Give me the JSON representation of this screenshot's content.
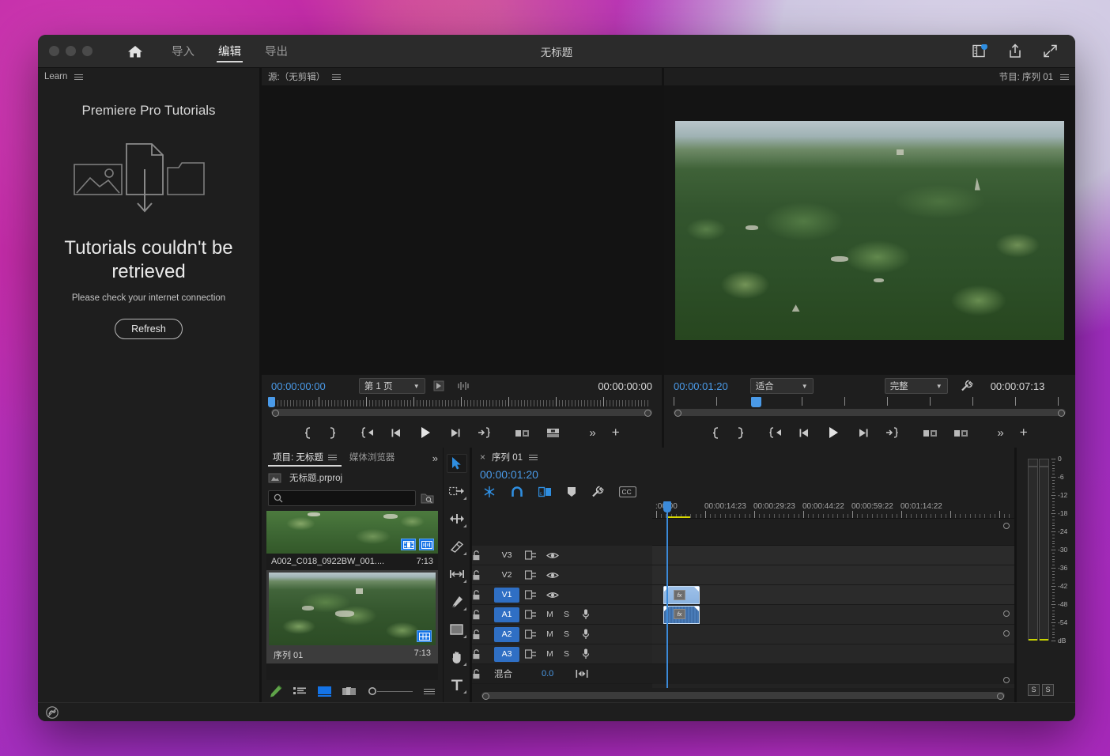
{
  "window": {
    "title": "无标题",
    "traffic_lights": [
      "close",
      "minimize",
      "maximize"
    ],
    "home_icon": "home-icon",
    "tabs": [
      {
        "label": "导入",
        "active": false
      },
      {
        "label": "编辑",
        "active": true
      },
      {
        "label": "导出",
        "active": false
      }
    ],
    "right_icons": [
      "progress-panel-icon",
      "share-icon",
      "fullscreen-icon"
    ]
  },
  "learn": {
    "panel_label": "Learn",
    "title": "Premiere Pro Tutorials",
    "error_title": "Tutorials couldn't be retrieved",
    "error_sub": "Please check your internet connection",
    "refresh_label": "Refresh"
  },
  "source_monitor": {
    "header": "源:（无剪辑）",
    "current_timecode": "00:00:00:00",
    "page_select": "第 1 页",
    "duration_timecode": "00:00:00:00",
    "transport": [
      "mark-in",
      "mark-out",
      "go-to-in",
      "step-back",
      "play",
      "step-forward",
      "go-to-out",
      "insert",
      "overwrite"
    ],
    "overflow_label": "»",
    "add_label": "+"
  },
  "program_monitor": {
    "header": "节目: 序列 01",
    "current_timecode": "00:00:01:20",
    "fit_select": "适合",
    "quality_select": "完整",
    "settings_icon": "wrench-icon",
    "duration_timecode": "00:00:07:13",
    "transport": [
      "mark-in",
      "mark-out",
      "go-to-in",
      "step-back",
      "play",
      "step-forward",
      "go-to-out",
      "lift",
      "extract"
    ],
    "overflow_label": "»",
    "add_label": "+"
  },
  "project_panel": {
    "tabs": [
      {
        "label": "项目: 无标题",
        "active": true
      },
      {
        "label": "媒体浏览器",
        "active": false
      }
    ],
    "overflow_label": "»",
    "project_file": "无标题.prproj",
    "search_placeholder": "",
    "items": [
      {
        "name": "A002_C018_0922BW_001....",
        "duration": "7:13",
        "badges": [
          "video-badge",
          "audio-badge"
        ],
        "selected": false
      },
      {
        "name": "序列 01",
        "duration": "7:13",
        "badges": [
          "sequence-badge"
        ],
        "selected": true
      }
    ],
    "footer_icons": [
      "new-item-pencil-icon",
      "list-view-icon",
      "icon-view-icon",
      "freeform-view-icon",
      "zoom-slider",
      "panel-menu-icon"
    ]
  },
  "tools": [
    {
      "name": "selection-tool",
      "active": true
    },
    {
      "name": "track-select-forward-tool",
      "active": false
    },
    {
      "name": "ripple-edit-tool",
      "active": false
    },
    {
      "name": "razor-tool",
      "active": false
    },
    {
      "name": "slip-tool",
      "active": false
    },
    {
      "name": "pen-tool",
      "active": false
    },
    {
      "name": "rectangle-tool",
      "active": false
    },
    {
      "name": "hand-tool",
      "active": false
    },
    {
      "name": "type-tool",
      "active": false
    }
  ],
  "timeline": {
    "close_label": "×",
    "sequence_name": "序列 01",
    "playhead_timecode": "00:00:01:20",
    "toolbar_icons": [
      "nested-sequence-icon",
      "snap-icon",
      "linked-selection-icon",
      "add-marker-icon",
      "timeline-settings-icon",
      "closed-captions-icon"
    ],
    "ruler_labels": [
      ":00:00",
      "00:00:14:23",
      "00:00:29:23",
      "00:00:44:22",
      "00:00:59:22",
      "00:01:14:22"
    ],
    "tracks": [
      {
        "name": "V3",
        "type": "video",
        "targeted": false,
        "lock": "unlocked",
        "sync": "sync-icon",
        "eye": "eye-icon"
      },
      {
        "name": "V2",
        "type": "video",
        "targeted": false,
        "lock": "unlocked",
        "sync": "sync-icon",
        "eye": "eye-icon"
      },
      {
        "name": "V1",
        "type": "video",
        "targeted": true,
        "lock": "unlocked",
        "sync": "sync-icon",
        "eye": "eye-icon"
      },
      {
        "name": "A1",
        "type": "audio",
        "targeted": true,
        "lock": "unlocked",
        "mute": "M",
        "solo": "S",
        "mic": "mic-icon"
      },
      {
        "name": "A2",
        "type": "audio",
        "targeted": true,
        "lock": "unlocked",
        "mute": "M",
        "solo": "S",
        "mic": "mic-icon"
      },
      {
        "name": "A3",
        "type": "audio",
        "targeted": true,
        "lock": "unlocked",
        "mute": "M",
        "solo": "S",
        "mic": "mic-icon"
      }
    ],
    "master_track": {
      "name": "混合",
      "value": "0.0",
      "meter_icon": "master-meter-icon"
    },
    "clips": [
      {
        "track": "V1",
        "label": "fx",
        "kind": "video"
      },
      {
        "track": "A1",
        "label": "fx",
        "kind": "audio"
      }
    ]
  },
  "audio_meters": {
    "scale_labels": [
      "0",
      "-6",
      "-12",
      "-18",
      "-24",
      "-30",
      "-36",
      "-42",
      "-48",
      "-54",
      "dB"
    ],
    "solo_buttons": [
      "S",
      "S"
    ]
  },
  "statusbar": {
    "icon": "creative-cloud-icon"
  },
  "colors": {
    "accent_blue": "#4a9ae8",
    "target_blue": "#2f6fc4",
    "clip_video": "#9dc0e8",
    "clip_audio": "#3f6ea8",
    "panel_bg": "#1e1e1e",
    "window_bg": "#1b1b1b"
  }
}
